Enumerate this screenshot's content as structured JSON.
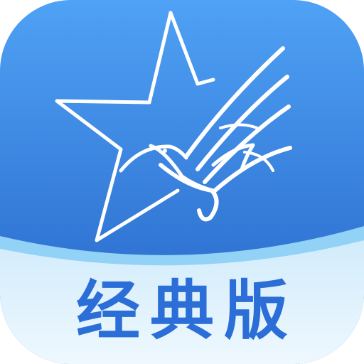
{
  "app_icon": {
    "label": "经典版",
    "logo": "star-eagle-logo",
    "colors": {
      "top_gradient_start": "#4a9bf2",
      "top_gradient_end": "#2566c9",
      "wave_band": "#8fd0f6",
      "bottom_panel": "#e4f4fd",
      "label_text": "#2c6ed8",
      "logo_stroke": "#ffffff"
    }
  }
}
